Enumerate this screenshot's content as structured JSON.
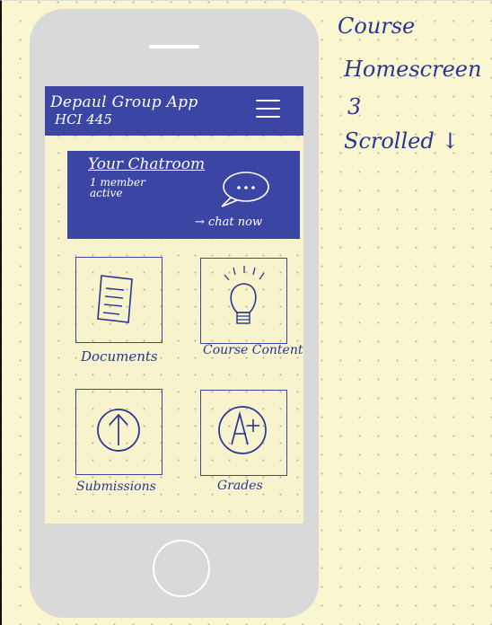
{
  "app_header": {
    "title": "Depaul Group App",
    "course_code": "HCI 445"
  },
  "chatroom": {
    "title": "Your Chatroom",
    "members": "1 member active",
    "cta": "→ chat now"
  },
  "tiles": [
    {
      "label": "Documents",
      "icon": "document-icon"
    },
    {
      "label": "Course Content",
      "icon": "lightbulb-icon"
    },
    {
      "label": "Submissions",
      "icon": "upload-arrow-icon"
    },
    {
      "label": "Grades",
      "icon": "grade-a-plus-icon"
    }
  ],
  "notes": {
    "line1": "Course",
    "line2": "Homescreen",
    "line3": "3",
    "line4": "Scrolled ↓"
  },
  "colors": {
    "brand": "#3b46a4",
    "ink": "#2a3592",
    "paper": "#faf6cf"
  }
}
